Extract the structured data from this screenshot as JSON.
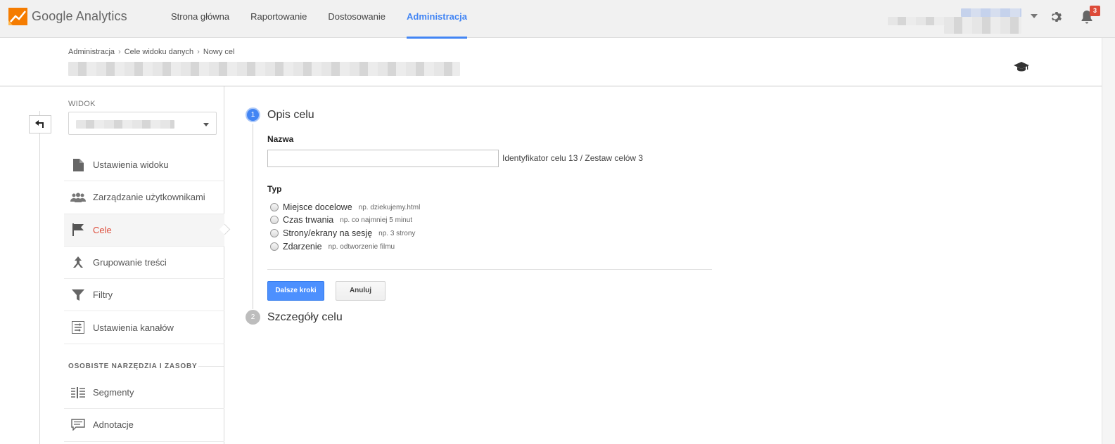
{
  "brand": {
    "name_google": "Google",
    "name_product": "Analytics",
    "logo_icon": "analytics-logo-icon",
    "colors": {
      "accent": "#4285f4",
      "orange": "#f57c00",
      "active_red": "#dd4b39"
    }
  },
  "nav": {
    "items": [
      {
        "label": "Strona główna"
      },
      {
        "label": "Raportowanie"
      },
      {
        "label": "Dostosowanie"
      },
      {
        "label": "Administracja"
      }
    ],
    "active": "Administracja"
  },
  "topbar": {
    "notifications_count": "3"
  },
  "breadcrumb": {
    "items": [
      "Administracja",
      "Cele widoku danych",
      "Nowy cel"
    ],
    "separator": "›"
  },
  "sidebar": {
    "view_label": "WIDOK",
    "menu": [
      {
        "label": "Ustawienia widoku",
        "icon": "document-icon"
      },
      {
        "label": "Zarządzanie użytkownikami",
        "icon": "users-icon"
      },
      {
        "label": "Cele",
        "icon": "flag-icon",
        "active": true
      },
      {
        "label": "Grupowanie treści",
        "icon": "content-grouping-icon"
      },
      {
        "label": "Filtry",
        "icon": "filter-icon"
      },
      {
        "label": "Ustawienia kanałów",
        "icon": "channel-settings-icon"
      }
    ],
    "section_title": "OSOBISTE NARZĘDZIA I ZASOBY",
    "menu2": [
      {
        "label": "Segmenty",
        "icon": "segments-icon"
      },
      {
        "label": "Adnotacje",
        "icon": "annotations-icon"
      }
    ]
  },
  "form": {
    "step1": {
      "number": "1",
      "title": "Opis celu"
    },
    "name_label": "Nazwa",
    "name_value": "",
    "goal_id_text": "Identyfikator celu 13 / Zestaw celów 3",
    "type_label": "Typ",
    "types": [
      {
        "label": "Miejsce docelowe",
        "hint": "np. dziekujemy.html"
      },
      {
        "label": "Czas trwania",
        "hint": "np. co najmniej 5 minut"
      },
      {
        "label": "Strony/ekrany na sesję",
        "hint": "np. 3 strony"
      },
      {
        "label": "Zdarzenie",
        "hint": "np. odtworzenie filmu"
      }
    ],
    "continue_label": "Dalsze kroki",
    "cancel_label": "Anuluj",
    "step2": {
      "number": "2",
      "title": "Szczegóły celu"
    }
  }
}
